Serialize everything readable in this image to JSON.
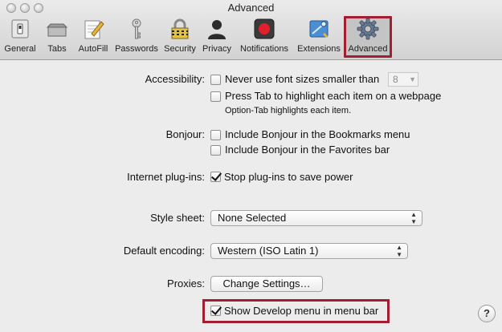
{
  "window": {
    "title": "Advanced"
  },
  "toolbar": {
    "items": [
      {
        "label": "General",
        "icon": "general-switch-icon"
      },
      {
        "label": "Tabs",
        "icon": "tabs-icon"
      },
      {
        "label": "AutoFill",
        "icon": "autofill-pencil-icon"
      },
      {
        "label": "Passwords",
        "icon": "key-icon"
      },
      {
        "label": "Security",
        "icon": "lock-icon"
      },
      {
        "label": "Privacy",
        "icon": "person-silhouette-icon"
      },
      {
        "label": "Notifications",
        "icon": "notifications-icon"
      },
      {
        "label": "Extensions",
        "icon": "extensions-puzzle-icon"
      },
      {
        "label": "Advanced",
        "icon": "gear-icon",
        "selected": true
      }
    ]
  },
  "accessibility": {
    "label": "Accessibility:",
    "font_size_option": "Never use font sizes smaller than",
    "font_size_value": "8",
    "font_size_checked": false,
    "tab_option": "Press Tab to highlight each item on a webpage",
    "tab_checked": false,
    "tab_note": "Option-Tab highlights each item."
  },
  "bonjour": {
    "label": "Bonjour:",
    "bookmarks_option": "Include Bonjour in the Bookmarks menu",
    "bookmarks_checked": false,
    "favorites_option": "Include Bonjour in the Favorites bar",
    "favorites_checked": false
  },
  "plugins": {
    "label": "Internet plug-ins:",
    "option": "Stop plug-ins to save power",
    "checked": true
  },
  "style_sheet": {
    "label": "Style sheet:",
    "value": "None Selected"
  },
  "encoding": {
    "label": "Default encoding:",
    "value": "Western (ISO Latin 1)"
  },
  "proxies": {
    "label": "Proxies:",
    "button": "Change Settings…"
  },
  "develop": {
    "option": "Show Develop menu in menu bar",
    "checked": true
  },
  "help": {
    "glyph": "?"
  },
  "colors": {
    "highlight": "#a21f33",
    "background": "#ececec"
  }
}
